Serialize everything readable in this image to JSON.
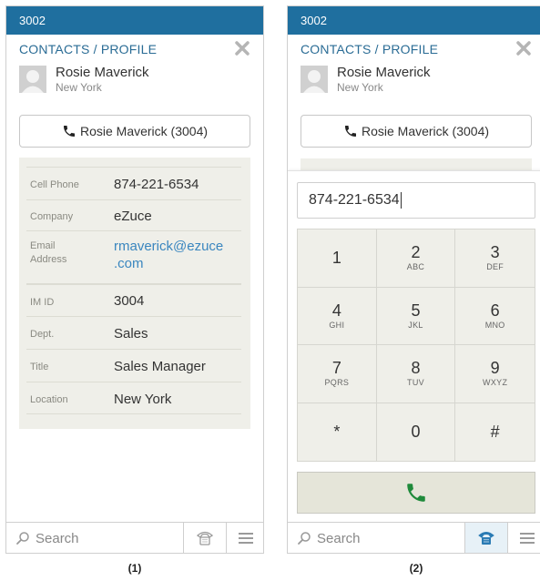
{
  "colors": {
    "topbar": "#1f6f9f",
    "link": "#3a86bf",
    "call_green": "#1f8a3b",
    "panel_gray": "#efefe9"
  },
  "panel1": {
    "topbar_title": "3002",
    "breadcrumb": "CONTACTS / PROFILE",
    "contact_name": "Rosie Maverick",
    "contact_city": "New York",
    "call_button_label": "Rosie Maverick (3004)",
    "details": [
      {
        "label": "Cell Phone",
        "value": "874-221-6534"
      },
      {
        "label": "Company",
        "value": "eZuce"
      },
      {
        "label": "Email",
        "label2": "Address",
        "value": "rmaverick@ezuce",
        "value2": ".com"
      },
      {
        "label": "IM ID",
        "value": "3004"
      },
      {
        "label": "Dept.",
        "value": "Sales"
      },
      {
        "label": "Title",
        "value": "Sales Manager"
      },
      {
        "label": "Location",
        "value": "New York"
      }
    ],
    "footer": {
      "search_placeholder": "Search"
    }
  },
  "panel2": {
    "topbar_title": "3002",
    "breadcrumb": "CONTACTS / PROFILE",
    "contact_name": "Rosie Maverick",
    "contact_city": "New York",
    "call_button_label": "Rosie Maverick (3004)",
    "dial_input_value": "874-221-6534",
    "keypad": [
      {
        "digit": "1",
        "letters": ""
      },
      {
        "digit": "2",
        "letters": "ABC"
      },
      {
        "digit": "3",
        "letters": "DEF"
      },
      {
        "digit": "4",
        "letters": "GHI"
      },
      {
        "digit": "5",
        "letters": "JKL"
      },
      {
        "digit": "6",
        "letters": "MNO"
      },
      {
        "digit": "7",
        "letters": "PQRS"
      },
      {
        "digit": "8",
        "letters": "TUV"
      },
      {
        "digit": "9",
        "letters": "WXYZ"
      },
      {
        "digit": "*",
        "letters": ""
      },
      {
        "digit": "0",
        "letters": ""
      },
      {
        "digit": "#",
        "letters": ""
      }
    ],
    "footer": {
      "search_placeholder": "Search"
    }
  },
  "captions": {
    "panel1": "(1)",
    "panel2": "(2)"
  },
  "icons": {
    "close": "close-icon",
    "avatar": "person-avatar-icon",
    "call": "phone-icon",
    "search": "search-icon",
    "dialpad": "dialpad-phone-icon",
    "menu": "hamburger-menu-icon"
  }
}
